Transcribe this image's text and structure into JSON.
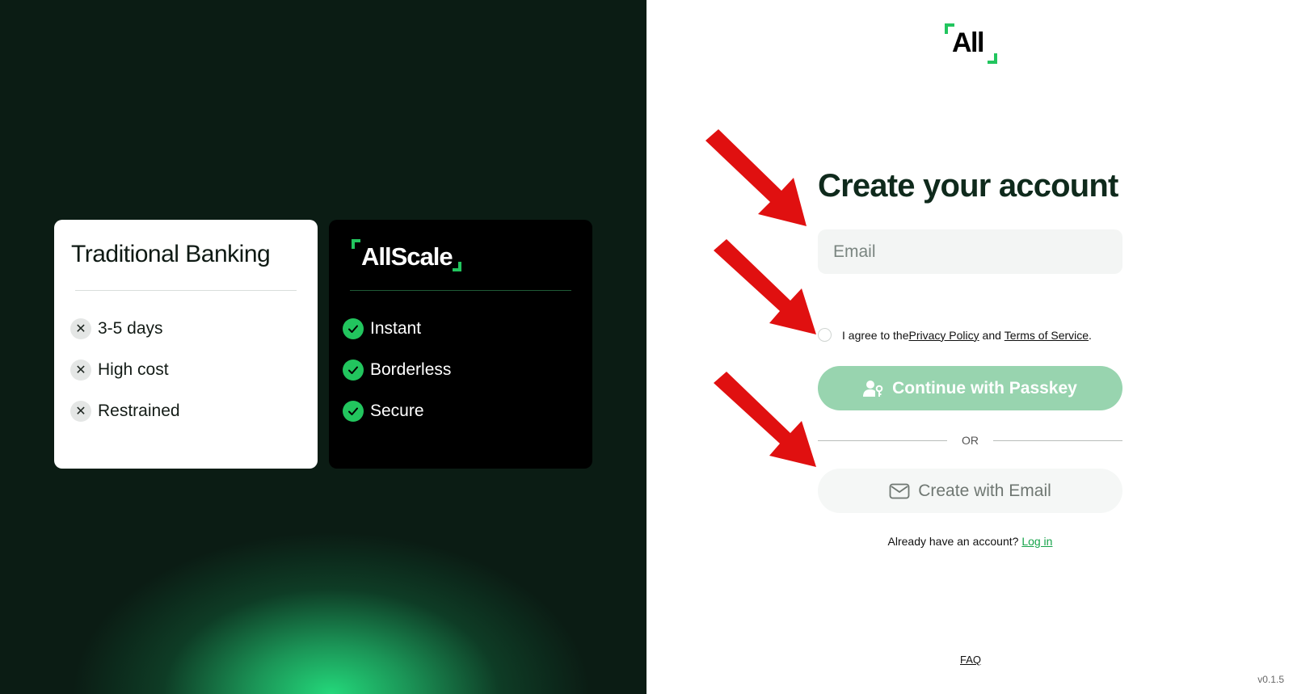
{
  "left": {
    "traditional": {
      "title": "Traditional Banking",
      "items": [
        "3-5 days",
        "High cost",
        "Restrained"
      ]
    },
    "allscale": {
      "logo_text": "AllScale",
      "items": [
        "Instant",
        "Borderless",
        "Secure"
      ]
    }
  },
  "right": {
    "logo_text": "All",
    "title": "Create your account",
    "email_placeholder": "Email",
    "agree": {
      "prefix": "I agree to the ",
      "privacy": "Privacy Policy",
      "middle": " and ",
      "terms": "Terms of Service",
      "suffix": "."
    },
    "passkey_button": "Continue with Passkey",
    "or_label": "OR",
    "email_button": "Create with Email",
    "login": {
      "prompt": "Already have an account? ",
      "link": "Log in"
    },
    "faq": "FAQ",
    "version": "v0.1.5"
  },
  "colors": {
    "accent_green": "#22c55e",
    "passkey_button": "#98d4af",
    "arrow_red": "#e01010",
    "left_bg": "#0b1c14"
  },
  "icons": [
    "close-icon",
    "check-icon",
    "passkey-user-icon",
    "mail-icon"
  ]
}
